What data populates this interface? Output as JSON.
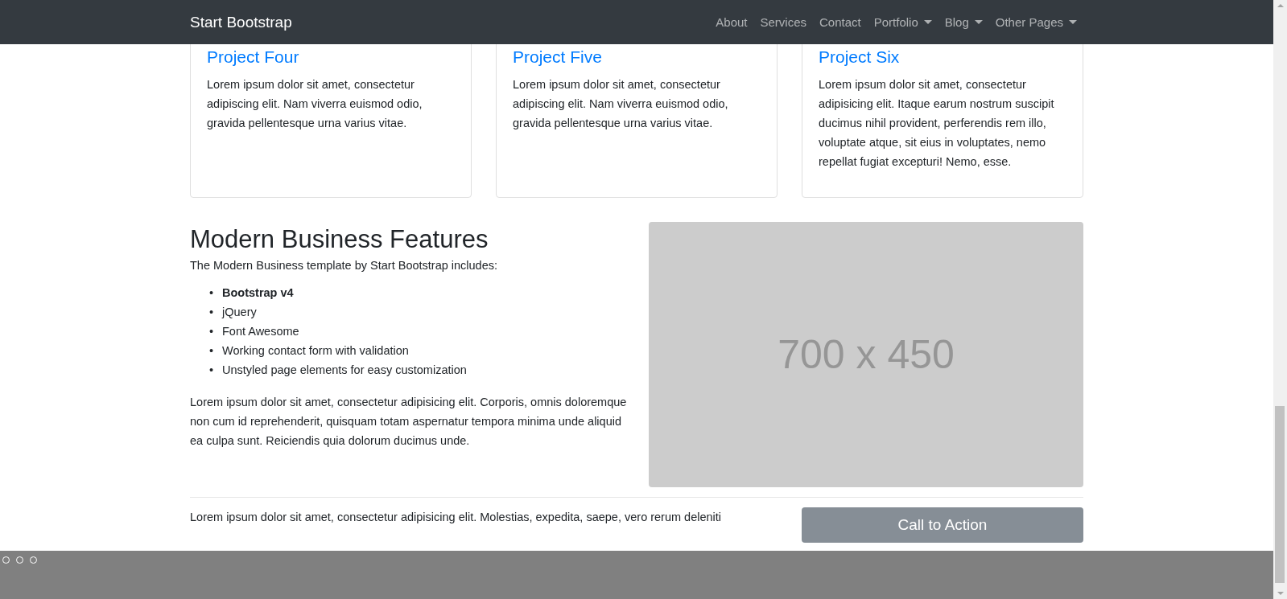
{
  "navbar": {
    "brand": "Start Bootstrap",
    "links": [
      {
        "label": "About",
        "dropdown": false
      },
      {
        "label": "Services",
        "dropdown": false
      },
      {
        "label": "Contact",
        "dropdown": false
      },
      {
        "label": "Portfolio",
        "dropdown": true
      },
      {
        "label": "Blog",
        "dropdown": true
      },
      {
        "label": "Other Pages",
        "dropdown": true
      }
    ]
  },
  "cards": [
    {
      "title": "Project Four",
      "text": "Lorem ipsum dolor sit amet, consectetur adipiscing elit. Nam viverra euismod odio, gravida pellentesque urna varius vitae."
    },
    {
      "title": "Project Five",
      "text": "Lorem ipsum dolor sit amet, consectetur adipiscing elit. Nam viverra euismod odio, gravida pellentesque urna varius vitae."
    },
    {
      "title": "Project Six",
      "text": "Lorem ipsum dolor sit amet, consectetur adipisicing elit. Itaque earum nostrum suscipit ducimus nihil provident, perferendis rem illo, voluptate atque, sit eius in voluptates, nemo repellat fugiat excepturi! Nemo, esse."
    }
  ],
  "features": {
    "heading": "Modern Business Features",
    "intro": "The Modern Business template by Start Bootstrap includes:",
    "marker": "•",
    "items": [
      "**Bootstrap v4**",
      "jQuery",
      "Font Awesome",
      "Working contact form with validation",
      "Unstyled page elements for easy customization"
    ],
    "paragraph": "Lorem ipsum dolor sit amet, consectetur adipisicing elit. Corporis, omnis doloremque non cum id reprehenderit, quisquam totam aspernatur tempora minima unde aliquid ea culpa sunt. Reiciendis quia dolorum ducimus unde.",
    "image_placeholder": "700 x 450"
  },
  "call_to_action": {
    "text": "Lorem ipsum dolor sit amet, consectetur adipisicing elit. Molestias, expedita, saepe, vero rerum deleniti",
    "button": "Call to Action"
  }
}
